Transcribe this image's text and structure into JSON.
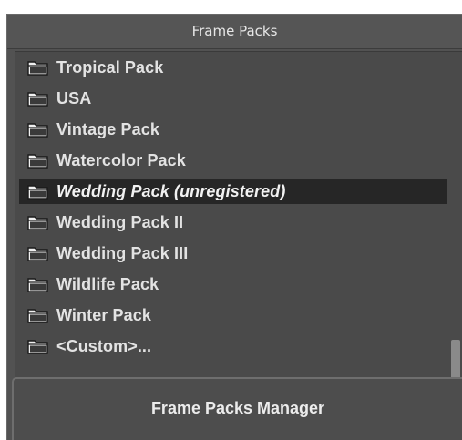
{
  "panel": {
    "title": "Frame Packs"
  },
  "packs": [
    {
      "label": "Tropical Pack",
      "selected": false
    },
    {
      "label": "USA",
      "selected": false
    },
    {
      "label": "Vintage Pack",
      "selected": false
    },
    {
      "label": "Watercolor Pack",
      "selected": false
    },
    {
      "label": "Wedding Pack (unregistered)",
      "selected": true
    },
    {
      "label": "Wedding Pack II",
      "selected": false
    },
    {
      "label": "Wedding Pack III",
      "selected": false
    },
    {
      "label": "Wildlife Pack",
      "selected": false
    },
    {
      "label": "Winter Pack",
      "selected": false
    },
    {
      "label": "<Custom>...",
      "selected": false
    }
  ],
  "manager_button": {
    "label": "Frame Packs Manager"
  },
  "icons": {
    "folder": "folder-icon"
  },
  "colors": {
    "panel_bg": "#525252",
    "list_bg": "#4a4a4a",
    "selected_bg": "#262626",
    "text": "#e3e3e3"
  }
}
